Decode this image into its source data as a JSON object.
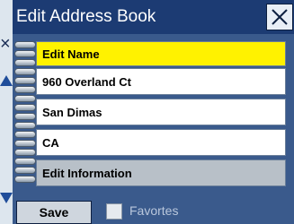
{
  "window": {
    "title": "Edit Address Book"
  },
  "colors": {
    "title_bar": "#1c3b73",
    "dialog_bg": "#3a5a8c",
    "highlight": "#fff200",
    "section_gray": "#b8c0c8"
  },
  "icons": {
    "close": "close-icon",
    "binding": "spiral-binding-icon",
    "up": "arrow-up-icon",
    "down": "arrow-down-icon"
  },
  "sections": {
    "edit_name": "Edit Name",
    "edit_information": "Edit Information"
  },
  "fields": {
    "street": "960 Overland Ct",
    "city": "San Dimas",
    "state": "CA"
  },
  "bottom": {
    "save_label": "Save",
    "favorites_label": "Favortes",
    "favorites_checked": false
  }
}
